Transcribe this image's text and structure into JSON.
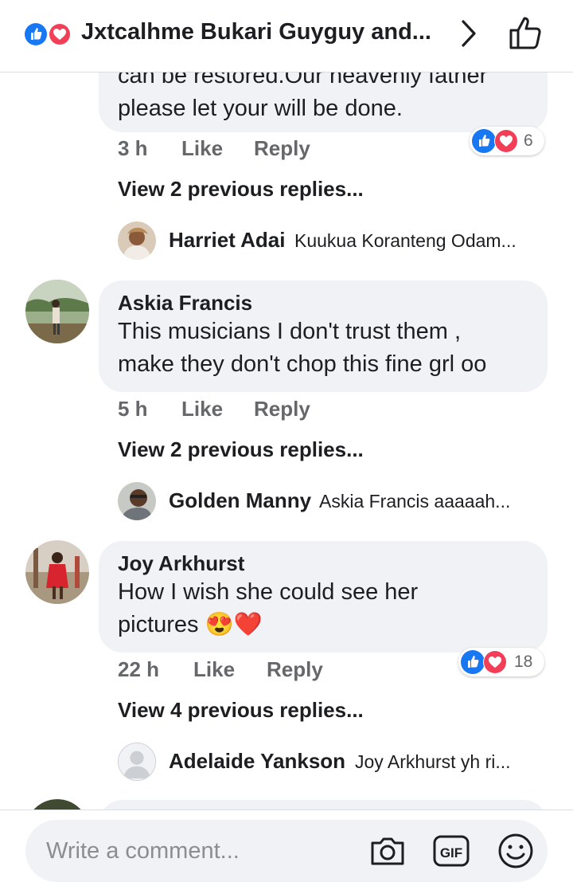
{
  "header": {
    "title": "Jxtcalhme Bukari Guyguy and..."
  },
  "comments": [
    {
      "text_lines": [
        "can be restored.Our heavenly father",
        "please let your will be done."
      ],
      "time": "3 h",
      "like": "Like",
      "reply": "Reply",
      "reaction_count": "6",
      "view_previous": "View 2 previous replies...",
      "last_reply": {
        "name": "Harriet Adai",
        "text": "Kuukua Koranteng Odam..."
      }
    },
    {
      "author": "Askia Francis",
      "text_lines": [
        "This musicians I don't trust them ,",
        "make they don't chop this fine grl oo"
      ],
      "time": "5 h",
      "like": "Like",
      "reply": "Reply",
      "view_previous": "View 2 previous replies...",
      "last_reply": {
        "name": "Golden Manny",
        "text": "Askia Francis aaaaah..."
      }
    },
    {
      "author": "Joy Arkhurst",
      "text_lines": [
        "How I wish she could see her",
        "pictures 😍❤️"
      ],
      "time": "22 h",
      "like": "Like",
      "reply": "Reply",
      "reaction_count": "18",
      "view_previous": "View 4 previous replies...",
      "last_reply": {
        "name": "Adelaide Yankson",
        "text": "Joy Arkhurst yh ri..."
      }
    }
  ],
  "composer": {
    "placeholder": "Write a comment..."
  },
  "colors": {
    "like_blue": "#1877f2",
    "love_red": "#f33e58",
    "bubble_bg": "#f0f2f5",
    "meta_gray": "#65676b"
  }
}
